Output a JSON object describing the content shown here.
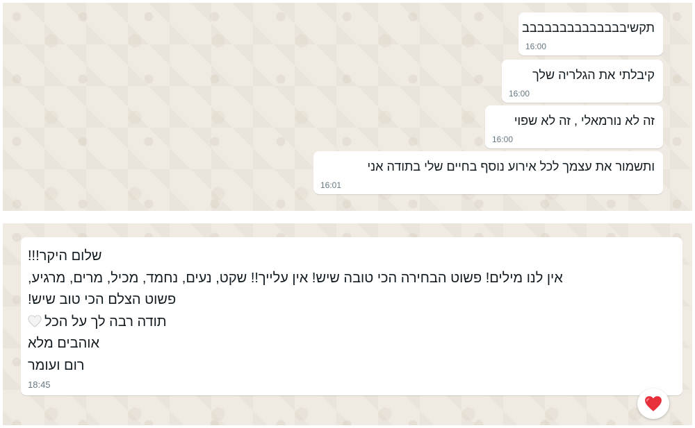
{
  "chat_top": {
    "messages": [
      {
        "text": "תקשיבבבבבבבבבבבבבב",
        "time": "16:00"
      },
      {
        "text": "קיבלתי את הגלריה שלך",
        "time": "16:00"
      },
      {
        "text": "זה לא נורמאלי , זה לא שפוי",
        "time": "16:00"
      },
      {
        "text": "ותשמור את עצמך לכל אירוע נוסף בחיים שלי בתודה אני",
        "time": "16:01"
      }
    ]
  },
  "chat_bottom": {
    "message": {
      "lines": [
        "שלום היקר!!!",
        "אין לנו מילים! פשוט הבחירה הכי טובה שיש! אין עלייך!! שקט, נעים, נחמד, מכיל, מרים, מרגיע,",
        "פשוט הצלם הכי טוב שיש!",
        "תודה רבה לך על הכל",
        "אוהבים מלא",
        "רום ועומר"
      ],
      "time": "18:45",
      "inline_icon": "white-heart-icon"
    },
    "reaction": {
      "icon": "red-heart-icon",
      "color": "#e8303c"
    }
  }
}
